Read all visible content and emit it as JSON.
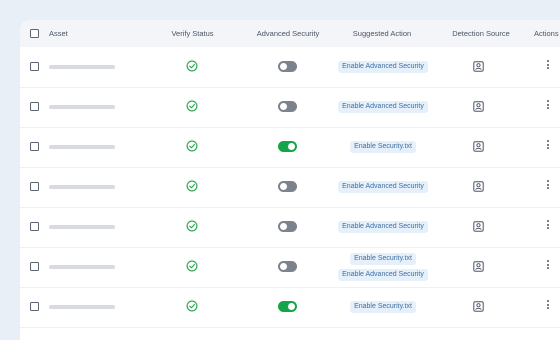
{
  "table": {
    "headers": {
      "asset": "Asset",
      "verify_status": "Verify Status",
      "advanced_security": "Advanced Security",
      "suggested_action": "Suggested Action",
      "detection_source": "Detection Source",
      "actions": "Actions"
    },
    "rows": [
      {
        "verified": true,
        "advanced_security": false,
        "actions": [
          "Enable Advanced Security"
        ]
      },
      {
        "verified": true,
        "advanced_security": false,
        "actions": [
          "Enable Advanced Security"
        ]
      },
      {
        "verified": true,
        "advanced_security": true,
        "actions": [
          "Enable Security.txt"
        ]
      },
      {
        "verified": true,
        "advanced_security": false,
        "actions": [
          "Enable Advanced Security"
        ]
      },
      {
        "verified": true,
        "advanced_security": false,
        "actions": [
          "Enable Advanced Security"
        ]
      },
      {
        "verified": true,
        "advanced_security": false,
        "actions": [
          "Enable Security.txt",
          "Enable Advanced Security"
        ]
      },
      {
        "verified": true,
        "advanced_security": true,
        "actions": [
          "Enable Security.txt"
        ]
      }
    ]
  },
  "icons": {
    "verify": "check-circle-icon",
    "detection": "user-badge-icon",
    "row_menu": "more-vertical-icon"
  },
  "colors": {
    "verified_green": "#22a34a",
    "toggle_on": "#17a34a",
    "toggle_off": "#7c838c",
    "pill_bg": "#e6f0fb",
    "pill_text": "#3f6ea3"
  }
}
